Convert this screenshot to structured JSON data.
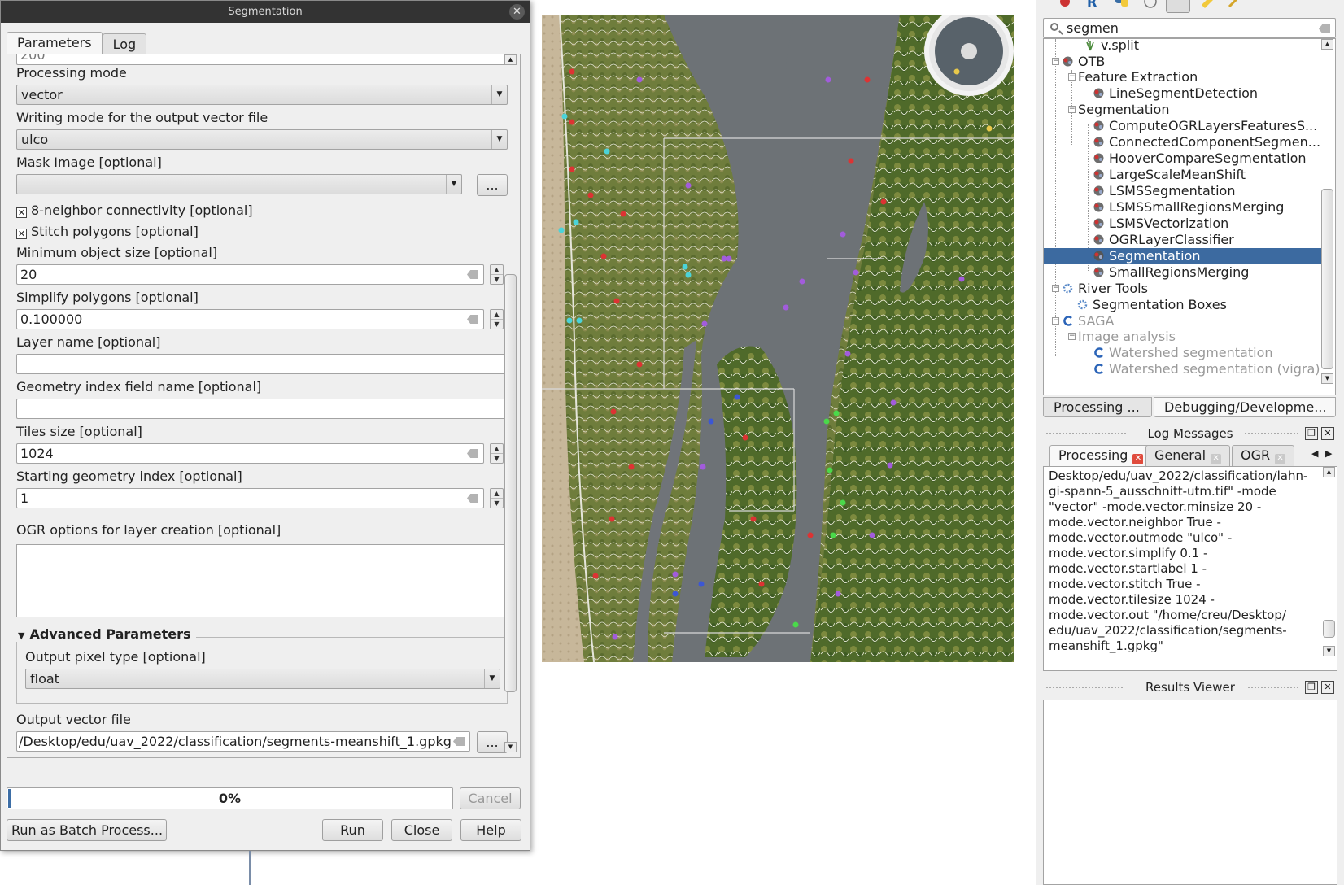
{
  "dialog": {
    "title": "Segmentation",
    "tabs": [
      "Parameters",
      "Log"
    ],
    "clipped_value": "200",
    "processing_mode": {
      "label": "Processing mode",
      "value": "vector"
    },
    "writing_mode": {
      "label": "Writing mode for the output vector file",
      "value": "ulco"
    },
    "mask_image": {
      "label": "Mask Image [optional]",
      "value": "",
      "browse": "..."
    },
    "neighbor": {
      "label": "8-neighbor connectivity [optional]",
      "checked": true
    },
    "stitch": {
      "label": "Stitch polygons [optional]",
      "checked": true
    },
    "min_object_size": {
      "label": "Minimum object size [optional]",
      "value": "20"
    },
    "simplify": {
      "label": "Simplify polygons [optional]",
      "value": "0.100000"
    },
    "layer_name": {
      "label": "Layer name [optional]",
      "value": ""
    },
    "geometry_index": {
      "label": "Geometry index field name [optional]",
      "value": ""
    },
    "tiles_size": {
      "label": "Tiles size [optional]",
      "value": "1024"
    },
    "start_index": {
      "label": "Starting geometry index [optional]",
      "value": "1"
    },
    "ogr_options": {
      "label": "OGR options for layer creation [optional]",
      "value": ""
    },
    "advanced": {
      "title": "Advanced Parameters",
      "pixel_type": {
        "label": "Output pixel type [optional]",
        "value": "float"
      }
    },
    "output": {
      "label": "Output vector file",
      "value": "/Desktop/edu/uav_2022/classification/segments-meanshift_1.gpkg",
      "browse": "..."
    },
    "progress": {
      "text": "0%",
      "value": 0
    },
    "buttons": {
      "cancel": "Cancel",
      "batch": "Run as Batch Process...",
      "run": "Run",
      "close": "Close",
      "help": "Help"
    }
  },
  "toolbox": {
    "search": "segmen",
    "tree": [
      {
        "label": "v.split",
        "level": 3,
        "icon": "grass-icon"
      },
      {
        "label": "OTB",
        "level": 1,
        "icon": "otb-icon"
      },
      {
        "label": "Feature Extraction",
        "level": 2,
        "icon": "none"
      },
      {
        "label": "LineSegmentDetection",
        "level": 3,
        "icon": "otb-icon"
      },
      {
        "label": "Segmentation",
        "level": 2,
        "icon": "none"
      },
      {
        "label": "ComputeOGRLayersFeaturesS...",
        "level": 3,
        "icon": "otb-icon"
      },
      {
        "label": "ConnectedComponentSegmen...",
        "level": 3,
        "icon": "otb-icon"
      },
      {
        "label": "HooverCompareSegmentation",
        "level": 3,
        "icon": "otb-icon"
      },
      {
        "label": "LargeScaleMeanShift",
        "level": 3,
        "icon": "otb-icon"
      },
      {
        "label": "LSMSSegmentation",
        "level": 3,
        "icon": "otb-icon"
      },
      {
        "label": "LSMSSmallRegionsMerging",
        "level": 3,
        "icon": "otb-icon"
      },
      {
        "label": "LSMSVectorization",
        "level": 3,
        "icon": "otb-icon"
      },
      {
        "label": "OGRLayerClassifier",
        "level": 3,
        "icon": "otb-icon"
      },
      {
        "label": "Segmentation",
        "level": 3,
        "icon": "otb-icon",
        "selected": true
      },
      {
        "label": "SmallRegionsMerging",
        "level": 3,
        "icon": "otb-icon"
      },
      {
        "label": "River Tools",
        "level": 1,
        "icon": "gear-icon"
      },
      {
        "label": "Segmentation Boxes",
        "level": 2,
        "icon": "gear-icon"
      },
      {
        "label": "SAGA",
        "level": 1,
        "icon": "saga-icon",
        "disabled": true
      },
      {
        "label": "Image analysis",
        "level": 2,
        "icon": "none",
        "disabled": true
      },
      {
        "label": "Watershed segmentation",
        "level": 3,
        "icon": "saga-icon",
        "disabled": true
      },
      {
        "label": "Watershed segmentation (vigra)",
        "level": 3,
        "icon": "saga-icon",
        "disabled": true
      }
    ],
    "bottom_tabs": [
      "Processing ...",
      "Debugging/Developme..."
    ]
  },
  "log_panel": {
    "title": "Log Messages",
    "tabs": [
      "Processing",
      "General",
      "OGR"
    ],
    "text": "Desktop/edu/uav_2022/classification/lahn-\ngi-spann-5_ausschnitt-utm.tif\" -mode\n\"vector\" -mode.vector.minsize 20 -\nmode.vector.neighbor True -\nmode.vector.outmode \"ulco\" -\nmode.vector.simplify 0.1 -\nmode.vector.startlabel 1 -\nmode.vector.stitch True -\nmode.vector.tilesize 1024 -\nmode.vector.out \"/home/creu/Desktop/\nedu/uav_2022/classification/segments-\nmeanshift_1.gpkg\""
  },
  "results_panel": {
    "title": "Results Viewer"
  },
  "colors": {
    "selection": "#3c6aa0",
    "water": "#6e7478",
    "vegetation": "#6b7a3a",
    "sand": "#c9b99a"
  }
}
